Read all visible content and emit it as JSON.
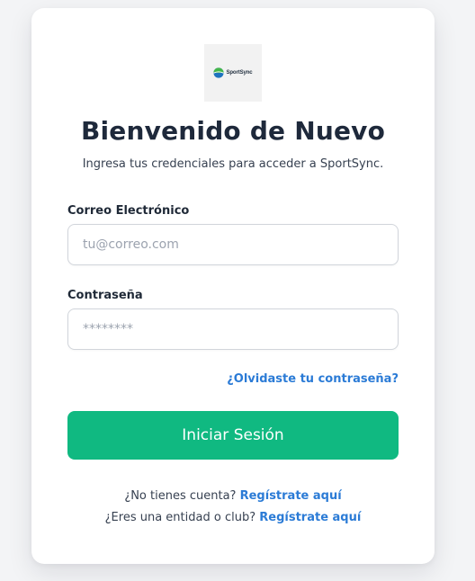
{
  "brand": {
    "logo_text": "SportSync",
    "logo_colors": {
      "green": "#43b649",
      "blue": "#1e73be"
    }
  },
  "header": {
    "title": "Bienvenido de Nuevo",
    "subtitle": "Ingresa tus credenciales para acceder a SportSync."
  },
  "form": {
    "email": {
      "label": "Correo Electrónico",
      "placeholder": "tu@correo.com",
      "value": ""
    },
    "password": {
      "label": "Contraseña",
      "placeholder": "********",
      "value": ""
    },
    "forgot_link": "¿Olvidaste tu contraseña?",
    "submit_label": "Iniciar Sesión"
  },
  "footer": {
    "no_account_text": "¿No tienes cuenta?",
    "register_link": "Regístrate aquí",
    "entity_text": "¿Eres una entidad o club?",
    "entity_register_link": "Regístrate aquí"
  },
  "colors": {
    "primary_button": "#10b981",
    "link": "#2b7bd6",
    "title_text": "#1e293b"
  }
}
